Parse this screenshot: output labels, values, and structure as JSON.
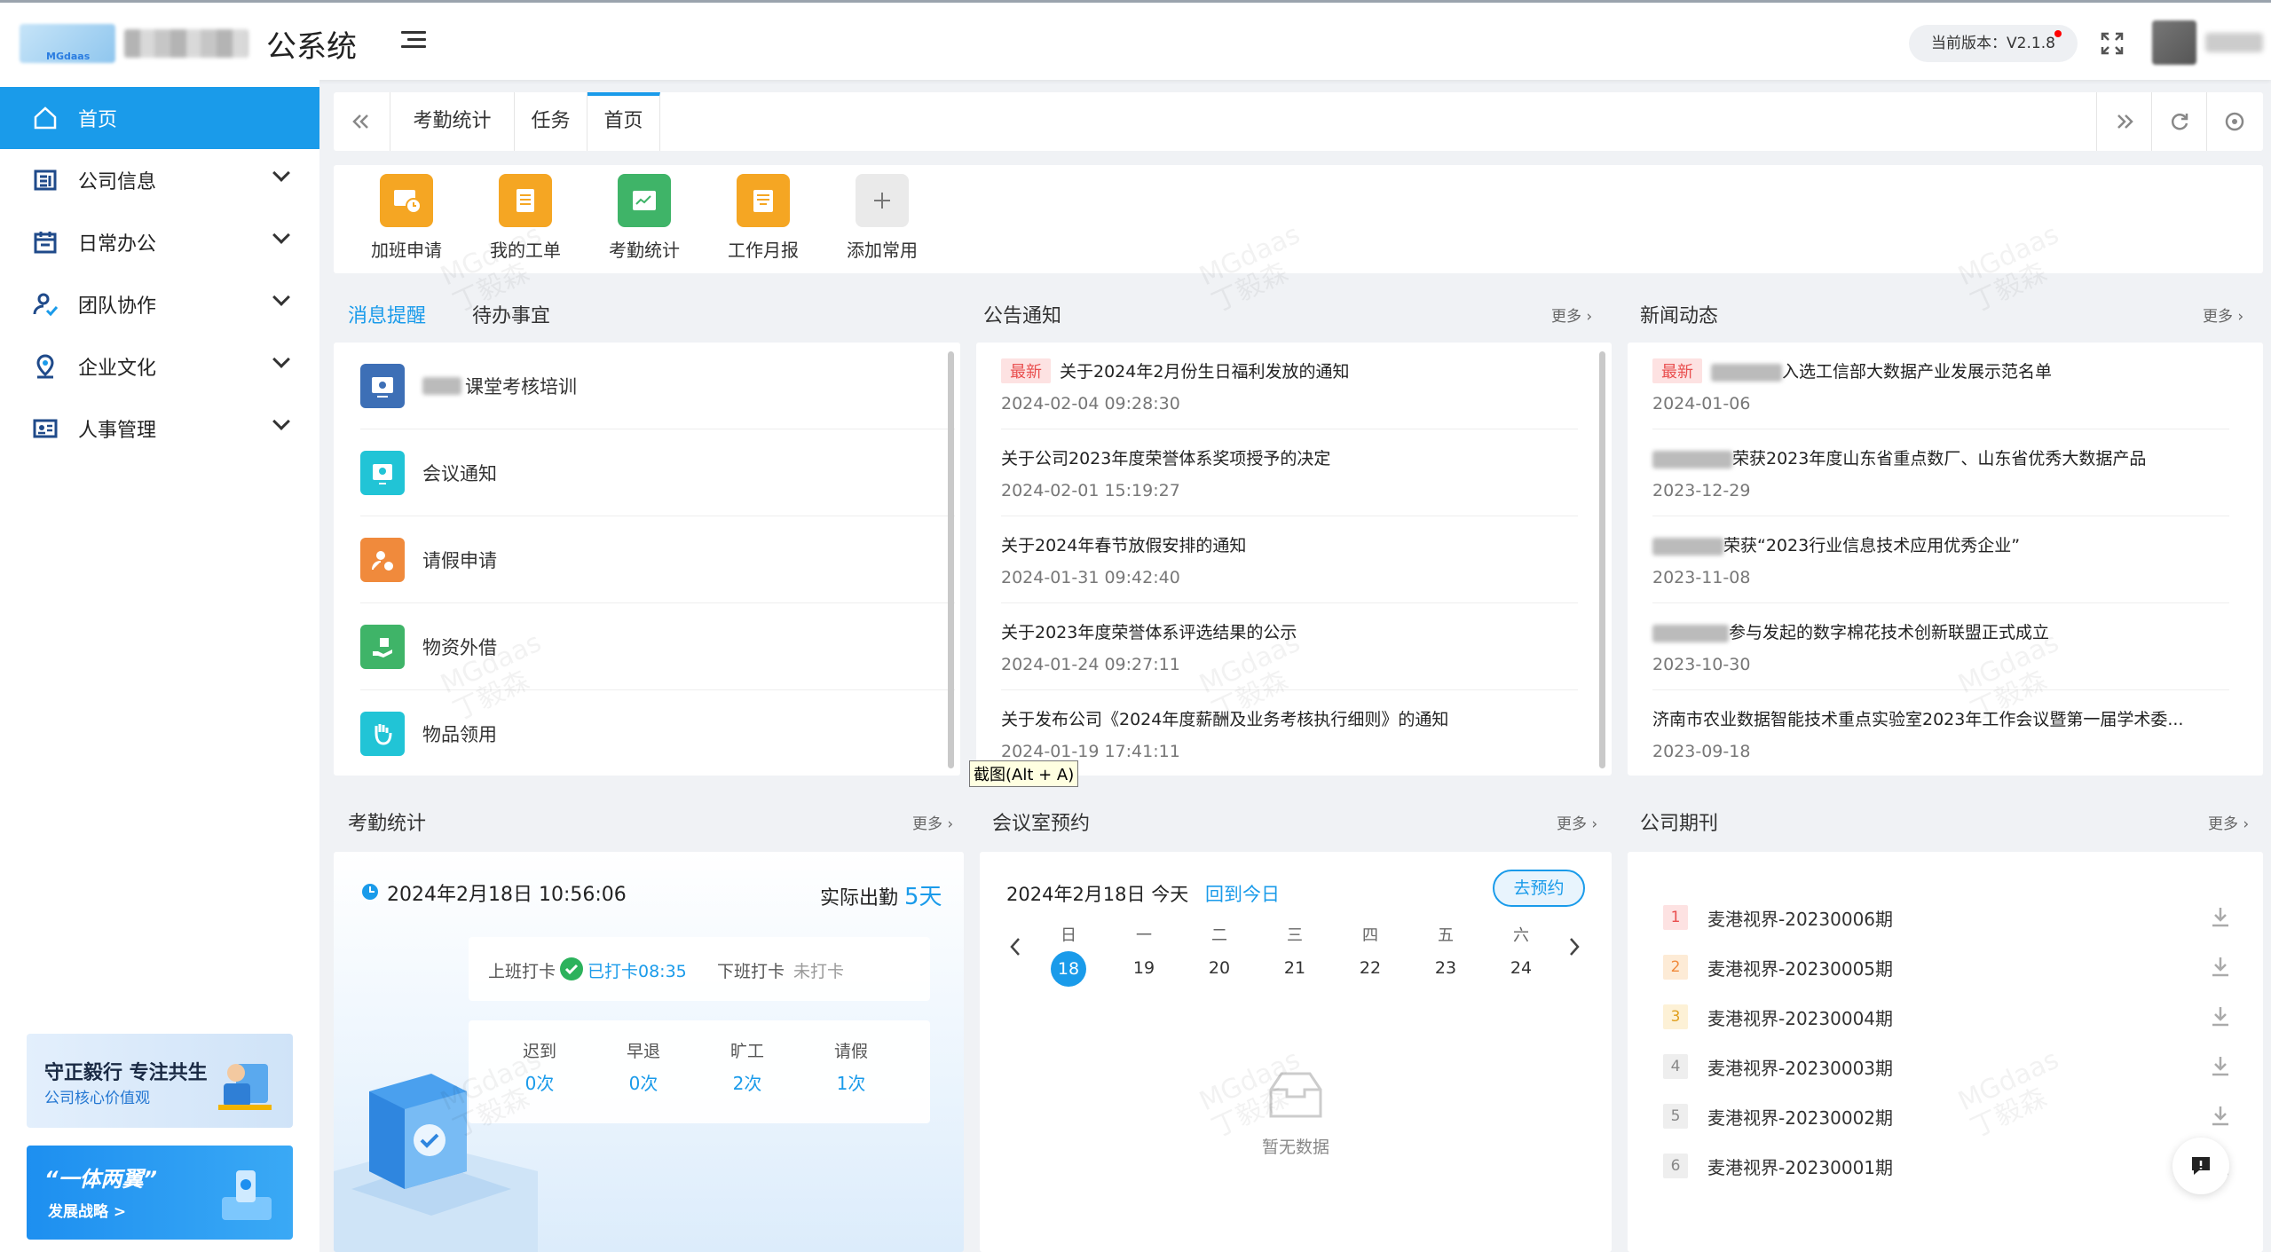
{
  "header": {
    "system_title": "公系统",
    "version_label": "当前版本：V2.1.8"
  },
  "sidebar": {
    "items": [
      {
        "label": "首页",
        "icon": "home-icon"
      },
      {
        "label": "公司信息",
        "icon": "company-info-icon"
      },
      {
        "label": "日常办公",
        "icon": "calendar-icon"
      },
      {
        "label": "团队协作",
        "icon": "team-icon"
      },
      {
        "label": "企业文化",
        "icon": "culture-icon"
      },
      {
        "label": "人事管理",
        "icon": "hr-icon"
      }
    ],
    "banner1": {
      "line1": "守正毅行 专注共生",
      "line2": "公司核心价值观"
    },
    "banner2": {
      "line1": "“一体两翼”",
      "line2": "发展战略 >"
    }
  },
  "tabs": [
    "考勤统计",
    "任务",
    "首页"
  ],
  "quick_actions": [
    {
      "label": "加班申请",
      "color": "#f5a623"
    },
    {
      "label": "我的工单",
      "color": "#f5a623"
    },
    {
      "label": "考勤统计",
      "color": "#3fb468"
    },
    {
      "label": "工作月报",
      "color": "#f5a623"
    },
    {
      "label": "添加常用",
      "color": "#e8e8e8"
    }
  ],
  "messages": {
    "tab_active": "消息提醒",
    "tab_other": "待办事宜",
    "items": [
      {
        "label": "课堂考核培训",
        "color": "#3d6fb6"
      },
      {
        "label": "会议通知",
        "color": "#21c4d6"
      },
      {
        "label": "请假申请",
        "color": "#f08a3c"
      },
      {
        "label": "物资外借",
        "color": "#3fb468"
      },
      {
        "label": "物品领用",
        "color": "#21c4d6"
      }
    ]
  },
  "announcements": {
    "title": "公告通知",
    "more": "更多",
    "new_tag": "最新",
    "items": [
      {
        "title": "关于2024年2月份生日福利发放的通知",
        "date": "2024-02-04 09:28:30"
      },
      {
        "title": "关于公司2023年度荣誉体系奖项授予的决定",
        "date": "2024-02-01 15:19:27"
      },
      {
        "title": "关于2024年春节放假安排的通知",
        "date": "2024-01-31 09:42:40"
      },
      {
        "title": "关于2023年度荣誉体系评选结果的公示",
        "date": "2024-01-24 09:27:11"
      },
      {
        "title": "关于发布公司《2024年度薪酬及业务考核执行细则》的通知",
        "date": "2024-01-19 17:41:11"
      }
    ]
  },
  "news": {
    "title": "新闻动态",
    "more": "更多",
    "new_tag": "最新",
    "items": [
      {
        "title": "入选工信部大数据产业发展示范名单",
        "date": "2024-01-06"
      },
      {
        "title": "荣获2023年度山东省重点数厂、山东省优秀大数据产品",
        "date": "2023-12-29"
      },
      {
        "title": "荣获“2023行业信息技术应用优秀企业”",
        "date": "2023-11-08"
      },
      {
        "title": "参与发起的数字棉花技术创新联盟正式成立",
        "date": "2023-10-30"
      },
      {
        "title": "济南市农业数据智能技术重点实验室2023年工作会议暨第一届学术委...",
        "date": "2023-09-18"
      }
    ]
  },
  "attendance": {
    "title": "考勤统计",
    "more": "更多",
    "datetime": "2024年2月18日 10:56:06",
    "actual_label": "实际出勤",
    "actual_value": "5天",
    "clock_in_label": "上班打卡",
    "clock_in_status": "已打卡08:35",
    "clock_out_label": "下班打卡",
    "clock_out_status": "未打卡",
    "stats": [
      {
        "label": "迟到",
        "value": "0次"
      },
      {
        "label": "早退",
        "value": "0次"
      },
      {
        "label": "旷工",
        "value": "2次"
      },
      {
        "label": "请假",
        "value": "1次"
      }
    ]
  },
  "meeting": {
    "title": "会议室预约",
    "more": "更多",
    "date_label": "2024年2月18日 今天",
    "back_today": "回到今日",
    "book_button": "去预约",
    "weekdays": [
      "日",
      "一",
      "二",
      "三",
      "四",
      "五",
      "六"
    ],
    "days": [
      "18",
      "19",
      "20",
      "21",
      "22",
      "23",
      "24"
    ],
    "empty": "暂无数据"
  },
  "journal": {
    "title": "公司期刊",
    "more": "更多",
    "items": [
      {
        "num": "1",
        "title": "麦港视界-20230006期"
      },
      {
        "num": "2",
        "title": "麦港视界-20230005期"
      },
      {
        "num": "3",
        "title": "麦港视界-20230004期"
      },
      {
        "num": "4",
        "title": "麦港视界-20230003期"
      },
      {
        "num": "5",
        "title": "麦港视界-20230002期"
      },
      {
        "num": "6",
        "title": "麦港视界-20230001期"
      }
    ]
  },
  "tooltip": "截图(Alt + A)",
  "watermark": {
    "line1": "MGdaas",
    "line2": "丁毅森"
  }
}
